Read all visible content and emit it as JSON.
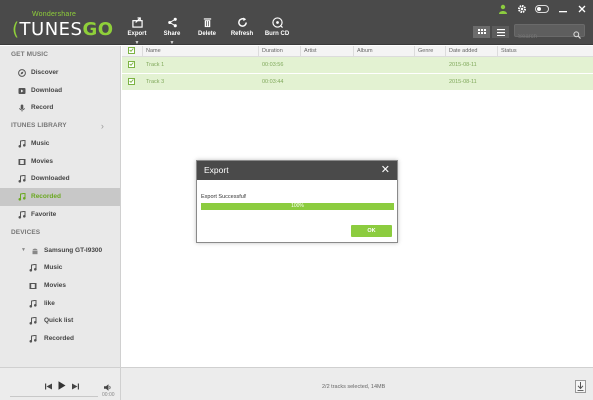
{
  "app": {
    "brand_small": "Wondershare",
    "brand_main": "TUNES",
    "brand_go": "GO"
  },
  "toolbar": {
    "export_label": "Export",
    "share_label": "Share",
    "delete_label": "Delete",
    "refresh_label": "Refresh",
    "burn_label": "Burn CD"
  },
  "search": {
    "placeholder": "Search"
  },
  "sidebar": {
    "get_music_label": "GET MUSIC",
    "discover": "Discover",
    "download": "Download",
    "record": "Record",
    "itunes_label": "ITUNES LIBRARY",
    "music": "Music",
    "movies": "Movies",
    "downloaded": "Downloaded",
    "recorded": "Recorded",
    "favorite": "Favorite",
    "devices_label": "DEVICES",
    "device_name": "Samsung GT-I9300",
    "dev_music": "Music",
    "dev_movies": "Movies",
    "dev_like": "like",
    "dev_quick": "Quick list",
    "dev_recorded": "Recorded"
  },
  "table": {
    "columns": [
      "Name",
      "Duration",
      "Artist",
      "Album",
      "Genre",
      "Date added",
      "Status"
    ],
    "rows": [
      {
        "name": "Track 1",
        "duration": "00:03:56",
        "artist": "",
        "album": "",
        "genre": "",
        "date": "2015-08-11",
        "status": ""
      },
      {
        "name": "Track 3",
        "duration": "00:03:44",
        "artist": "",
        "album": "",
        "genre": "",
        "date": "2015-08-11",
        "status": ""
      }
    ]
  },
  "dialog": {
    "title": "Export",
    "close": "✕",
    "message": "Export Successful!",
    "progress_text": "100%",
    "progress": 1.0,
    "ok_label": "OK"
  },
  "footer": {
    "time": "00:00",
    "status": "2/2 tracks selected, 14MB"
  },
  "colors": {
    "accent": "#8ccc3f",
    "header": "#4a4a4a"
  }
}
